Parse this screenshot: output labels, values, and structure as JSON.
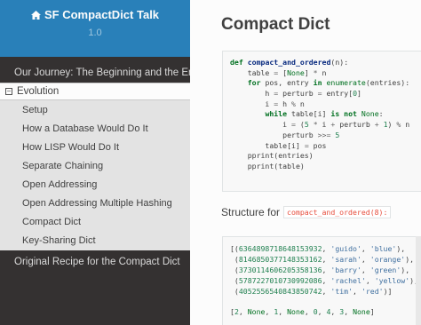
{
  "sidebar": {
    "title": "SF CompactDict Talk",
    "version": "1.0",
    "toc": {
      "journey": "Our Journey: The Beginning and the End",
      "evolution": "Evolution",
      "evolution_toggle": "⊟",
      "items": [
        "Setup",
        "How a Database Would Do It",
        "How LISP Would Do It",
        "Separate Chaining",
        "Open Addressing",
        "Open Addressing Multiple Hashing",
        "Compact Dict",
        "Key-Sharing Dict"
      ],
      "original": "Original Recipe for the Compact Dict"
    }
  },
  "main": {
    "title": "Compact Dict",
    "code_lines": [
      "def compact_and_ordered(n):",
      "    table = [None] * n",
      "    for pos, entry in enumerate(entries):",
      "        h = perturb = entry[0]",
      "        i = h % n",
      "        while table[i] is not None:",
      "            i = (5 * i + perturb + 1) % n",
      "            perturb >>= 5",
      "        table[i] = pos",
      "    pprint(entries)",
      "    pprint(table)"
    ],
    "structure_label": "Structure for",
    "structure_code": "compact_and_ordered(8):",
    "output_lines": [
      "[(6364898718648153932, 'guido', 'blue'),",
      " (8146850377148353162, 'sarah', 'orange'),",
      " (3730114606205358136, 'barry', 'green'),",
      " (5787227010730992086, 'rachel', 'yellow'),",
      " (4052556540843850742, 'tim', 'red')]",
      "",
      "[2, None, 1, None, 0, 4, 3, None]"
    ]
  },
  "colors": {
    "sidebar_bg": "#343131",
    "header_bg": "#2980b9",
    "current_section_bg": "#e3e3e3",
    "keyword": "#007020",
    "string": "#4070a0",
    "number": "#208050",
    "inline_code": "#e74c3c"
  },
  "icons": {
    "home": "home-icon",
    "collapse": "minus-square-icon"
  }
}
